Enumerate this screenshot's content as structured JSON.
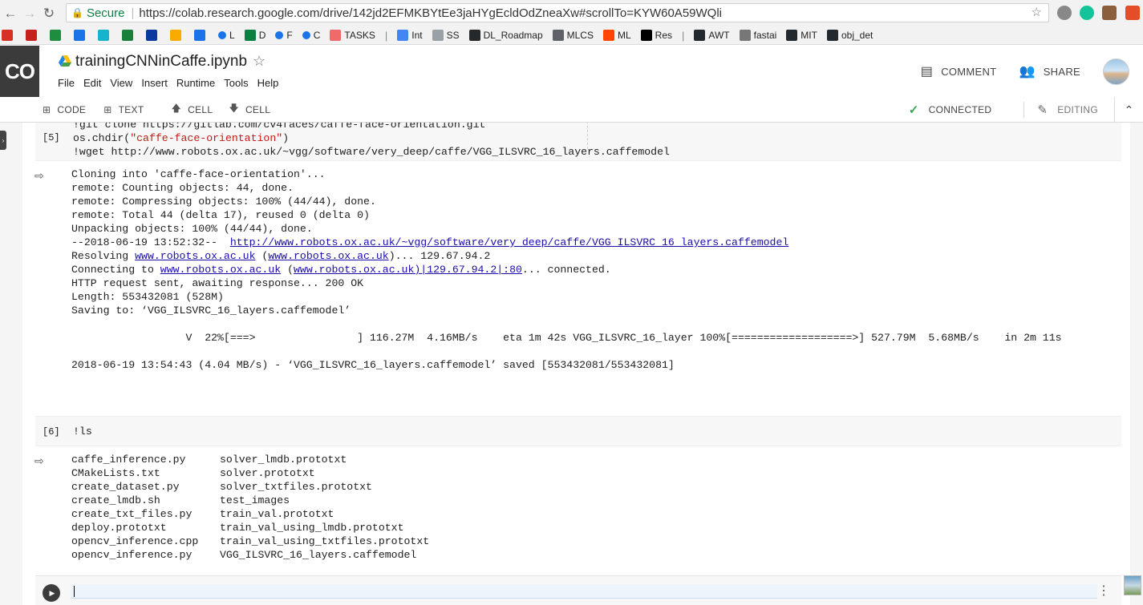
{
  "browser": {
    "secure_label": "Secure",
    "url": "https://colab.research.google.com/drive/142jd2EFMKBYtEe3jaHYgEcldOdZneaXw#scrollTo=KYW60A59WQli"
  },
  "bookmarks": [
    {
      "label": "",
      "icon": "gmail-icon",
      "color": "#d93025"
    },
    {
      "label": "",
      "icon": "bookmark-icon-red",
      "color": "#c5221f"
    },
    {
      "label": "",
      "icon": "drive-icon",
      "color": "#1e8e3e"
    },
    {
      "label": "",
      "icon": "bookmark-icon-blue",
      "color": "#1a73e8"
    },
    {
      "label": "",
      "icon": "bookmark-icon-teal",
      "color": "#12b5cb"
    },
    {
      "label": "",
      "icon": "bookmark-icon-green",
      "color": "#188038"
    },
    {
      "label": "",
      "icon": "jio-icon",
      "color": "#0a3a9e"
    },
    {
      "label": "",
      "icon": "analytics-icon",
      "color": "#f9ab00"
    },
    {
      "label": "",
      "icon": "bookmark-icon-shield",
      "color": "#1a73e8"
    },
    {
      "label": "L",
      "icon": "dot-icon",
      "color": "#1a73e8"
    },
    {
      "label": "D",
      "icon": "t-icon",
      "color": "#0b8043"
    },
    {
      "label": "F",
      "icon": "dot-icon",
      "color": "#1a73e8"
    },
    {
      "label": "C",
      "icon": "dot-icon",
      "color": "#1a73e8"
    },
    {
      "label": "TASKS",
      "icon": "asana-icon",
      "color": "#f06a6a"
    },
    {
      "label": "Int",
      "icon": "docs-icon",
      "color": "#4285f4"
    },
    {
      "label": "SS",
      "icon": "page-icon",
      "color": "#9aa0a6"
    },
    {
      "label": "DL_Roadmap",
      "icon": "github-icon",
      "color": "#24292e"
    },
    {
      "label": "MLCS",
      "icon": "grid-icon",
      "color": "#5f6368"
    },
    {
      "label": "ML",
      "icon": "reddit-icon",
      "color": "#ff4500"
    },
    {
      "label": "Res",
      "icon": "medium-icon",
      "color": "#000000"
    },
    {
      "label": "AWT",
      "icon": "github-icon",
      "color": "#24292e"
    },
    {
      "label": "fastai",
      "icon": "discourse-icon",
      "color": "#777777"
    },
    {
      "label": "MIT",
      "icon": "github-icon",
      "color": "#24292e"
    },
    {
      "label": "obj_det",
      "icon": "github-icon",
      "color": "#24292e"
    }
  ],
  "header": {
    "logo": "CO",
    "title": "trainingCNNinCaffe.ipynb",
    "menus": [
      "File",
      "Edit",
      "View",
      "Insert",
      "Runtime",
      "Tools",
      "Help"
    ],
    "comment_label": "COMMENT",
    "share_label": "SHARE"
  },
  "toolbar": {
    "code_label": "CODE",
    "text_label": "TEXT",
    "cell_up_label": "CELL",
    "cell_down_label": "CELL",
    "connected_label": "CONNECTED",
    "editing_label": "EDITING"
  },
  "cells": {
    "cell5": {
      "count": "[5]",
      "line0": "!git clone https://gitlab.com/cv4faces/caffe-face-orientation.git",
      "line1_prefix": "os.chdir(",
      "line1_str": "\"caffe-face-orientation\"",
      "line1_suffix": ")",
      "line2": "!wget http://www.robots.ox.ac.uk/~vgg/software/very_deep/caffe/VGG_ILSVRC_16_layers.caffemodel",
      "out": {
        "l1": "Cloning into 'caffe-face-orientation'...",
        "l2": "remote: Counting objects: 44, done.",
        "l3": "remote: Compressing objects: 100% (44/44), done.",
        "l4": "remote: Total 44 (delta 17), reused 0 (delta 0)",
        "l5": "Unpacking objects: 100% (44/44), done.",
        "l6_prefix": "--2018-06-19 13:52:32--  ",
        "l6_link": "http://www.robots.ox.ac.uk/~vgg/software/very_deep/caffe/VGG_ILSVRC_16_layers.caffemodel",
        "l7_a": "Resolving ",
        "l7_link1": "www.robots.ox.ac.uk",
        "l7_b": " (",
        "l7_link2": "www.robots.ox.ac.uk",
        "l7_c": ")... 129.67.94.2",
        "l8_a": "Connecting to ",
        "l8_link1": "www.robots.ox.ac.uk",
        "l8_b": " (",
        "l8_link2": "www.robots.ox.ac.uk)|129.67.94.2|:80",
        "l8_c": "... connected.",
        "l9": "HTTP request sent, awaiting response... 200 OK",
        "l10": "Length: 553432081 (528M)",
        "l11": "Saving to: ‘VGG_ILSVRC_16_layers.caffemodel’",
        "l12": "                  V  22%[===>                ] 116.27M  4.16MB/s    eta 1m 42s VGG_ILSVRC_16_layer 100%[===================>] 527.79M  5.68MB/s    in 2m 11s",
        "l13": "2018-06-19 13:54:43 (4.04 MB/s) - ‘VGG_ILSVRC_16_layers.caffemodel’ saved [553432081/553432081]"
      }
    },
    "cell6": {
      "count": "[6]",
      "code": "!ls",
      "files": [
        [
          "caffe_inference.py",
          "solver_lmdb.prototxt"
        ],
        [
          "CMakeLists.txt",
          "solver.prototxt"
        ],
        [
          "create_dataset.py",
          "solver_txtfiles.prototxt"
        ],
        [
          "create_lmdb.sh",
          "test_images"
        ],
        [
          "create_txt_files.py",
          "train_val.prototxt"
        ],
        [
          "deploy.prototxt",
          "train_val_using_lmdb.prototxt"
        ],
        [
          "opencv_inference.cpp",
          "train_val_using_txtfiles.prototxt"
        ],
        [
          "opencv_inference.py",
          "VGG_ILSVRC_16_layers.caffemodel"
        ]
      ]
    }
  }
}
